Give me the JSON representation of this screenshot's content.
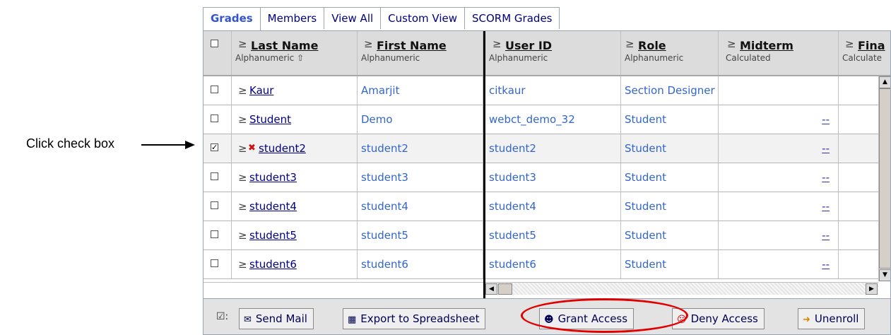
{
  "annotation": {
    "label": "Click check box"
  },
  "tabs": [
    {
      "label": "Grades",
      "active": true
    },
    {
      "label": "Members"
    },
    {
      "label": "View All"
    },
    {
      "label": "Custom View"
    },
    {
      "label": "SCORM Grades"
    }
  ],
  "columns": [
    {
      "title": "Last Name",
      "sub": "Alphanumeric ⇧"
    },
    {
      "title": "First Name",
      "sub": "Alphanumeric"
    },
    {
      "title": "User ID",
      "sub": "Alphanumeric"
    },
    {
      "title": "Role",
      "sub": "Alphanumeric"
    },
    {
      "title": "Midterm",
      "sub": "Calculated"
    },
    {
      "title": "Fina",
      "sub": "Calculate"
    }
  ],
  "rows": [
    {
      "last": "Kaur",
      "first": "Amarjit",
      "userid": "citkaur",
      "role": "Section Designer",
      "midterm": "",
      "checked": false,
      "status_icon": false
    },
    {
      "last": "Student",
      "first": "Demo",
      "userid": "webct_demo_32",
      "role": "Student",
      "midterm": "--",
      "checked": false,
      "status_icon": false
    },
    {
      "last": "student2",
      "first": "student2",
      "userid": "student2",
      "role": "Student",
      "midterm": "--",
      "checked": true,
      "status_icon": true
    },
    {
      "last": "student3",
      "first": "student3",
      "userid": "student3",
      "role": "Student",
      "midterm": "--",
      "checked": false,
      "status_icon": false
    },
    {
      "last": "student4",
      "first": "student4",
      "userid": "student4",
      "role": "Student",
      "midterm": "--",
      "checked": false,
      "status_icon": false
    },
    {
      "last": "student5",
      "first": "student5",
      "userid": "student5",
      "role": "Student",
      "midterm": "--",
      "checked": false,
      "status_icon": false
    },
    {
      "last": "student6",
      "first": "student6",
      "userid": "student6",
      "role": "Student",
      "midterm": "--",
      "checked": false,
      "status_icon": false
    }
  ],
  "actions": {
    "send_mail": "Send Mail",
    "export": "Export to Spreadsheet",
    "grant": "Grant Access",
    "deny": "Deny Access",
    "unenroll": "Unenroll"
  },
  "colors": {
    "highlight": "#e10000",
    "link": "#000080",
    "value": "#3366cc"
  }
}
